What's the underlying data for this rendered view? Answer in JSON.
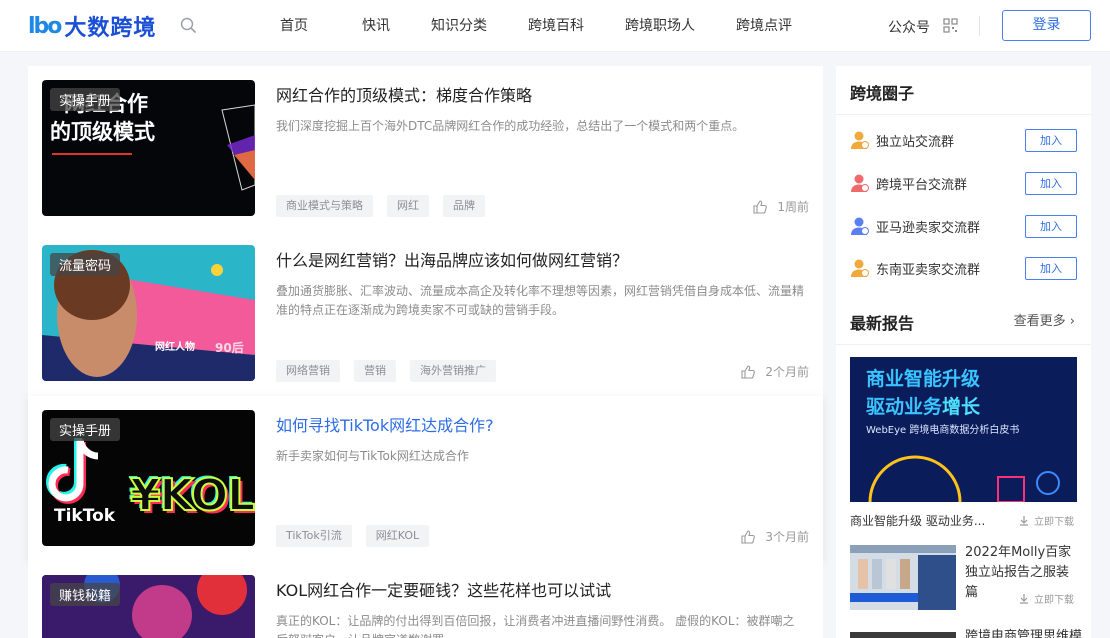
{
  "header": {
    "logo_mark": "lbo",
    "logo_text": "大数跨境",
    "nav": [
      "首页",
      "快讯",
      "知识分类",
      "跨境百科",
      "跨境职场人",
      "跨境点评"
    ],
    "gzh_label": "公众号",
    "login_label": "登录"
  },
  "articles": [
    {
      "badge": "实操手册",
      "thumb_text": [
        "网红合作",
        "的顶级模式"
      ],
      "title": "网红合作的顶级模式：梯度合作策略",
      "desc": "我们深度挖掘上百个海外DTC品牌网红合作的成功经验，总结出了一个模式和两个重点。",
      "tags": [
        "商业模式与策略",
        "网红",
        "品牌"
      ],
      "time": "1周前"
    },
    {
      "badge": "流量密码",
      "thumb_text": [
        "网红人物",
        "90后"
      ],
      "title": "什么是网红营销？出海品牌应该如何做网红营销？",
      "desc": "叠加通货膨胀、汇率波动、流量成本高企及转化率不理想等因素，网红营销凭借自身成本低、流量精准的特点正在逐渐成为跨境卖家不可或缺的营销手段。",
      "tags": [
        "网络营销",
        "营销",
        "海外营销推广"
      ],
      "time": "2个月前"
    },
    {
      "badge": "实操手册",
      "thumb_text": [
        "TikTok",
        "¥KOL"
      ],
      "title": "如何寻找TikTok网红达成合作?",
      "desc": "新手卖家如何与TikTok网红达成合作",
      "tags": [
        "TikTok引流",
        "网红KOL"
      ],
      "time": "3个月前"
    },
    {
      "badge": "赚钱秘籍",
      "title": "KOL网红合作一定要砸钱？这些花样也可以试试",
      "desc": "真正的KOL：让品牌的付出得到百倍回报，让消费者冲进直播间野性消费。 虚假的KOL：被群嘲之后怒怼客户，让品牌官道歉谢罪"
    }
  ],
  "sidebar": {
    "circle_title": "跨境圈子",
    "circles": [
      {
        "name": "独立站交流群",
        "join": "加入",
        "color": "#f0a93b"
      },
      {
        "name": "跨境平台交流群",
        "join": "加入",
        "color": "#ef6a6a"
      },
      {
        "name": "亚马逊卖家交流群",
        "join": "加入",
        "color": "#5a7ff0"
      },
      {
        "name": "东南亚卖家交流群",
        "join": "加入",
        "color": "#f0a93b"
      }
    ],
    "report_title": "最新报告",
    "more": "查看更多",
    "report1_cover_line1": "商业智能升级",
    "report1_cover_line2a": "驱动业务",
    "report1_cover_line2b": "增长",
    "report1_cover_sub": "WebEye 跨境电商数据分析白皮书",
    "report1_caption": "商业智能升级 驱动业务...",
    "download": "立即下载",
    "report2_title": "2022年Molly百家独立站报告之服装篇",
    "report3_title": "跨境电商管理思维模"
  }
}
